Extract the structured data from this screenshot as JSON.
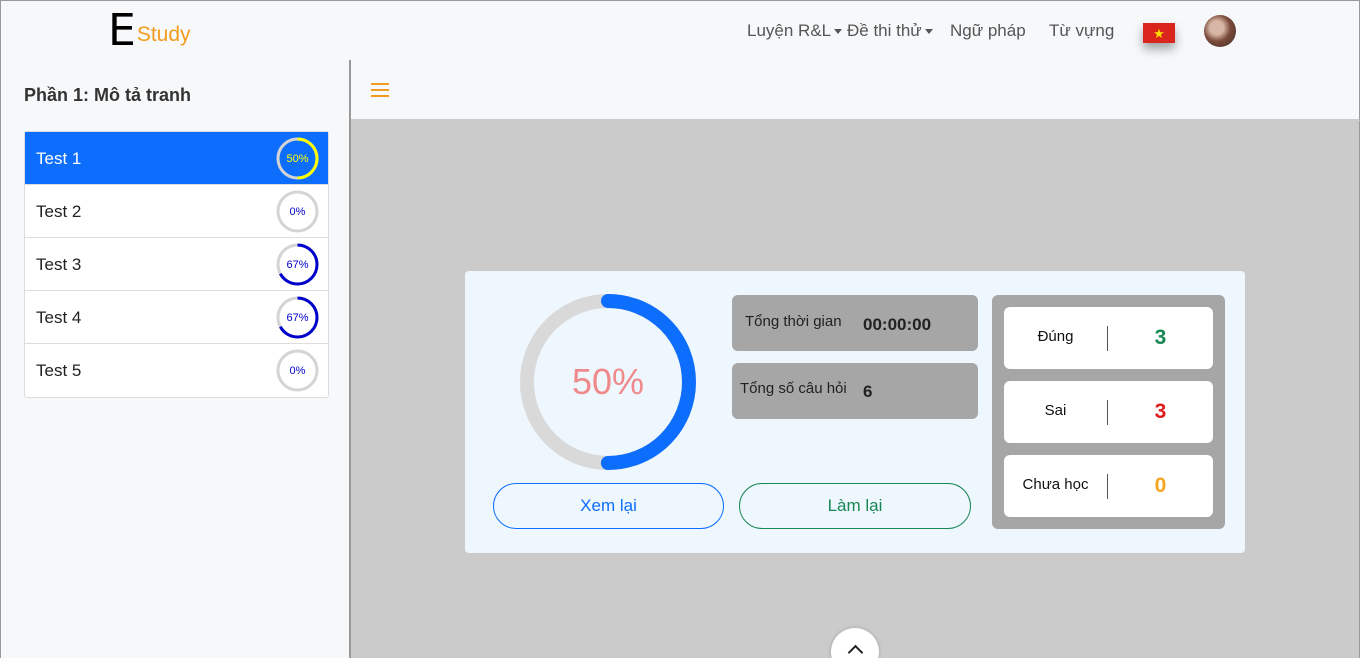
{
  "brand": {
    "letter": "E",
    "name": "Study"
  },
  "nav": {
    "practice": "Luyện R&L",
    "mock_test": "Đề thi thử",
    "grammar": "Ngữ pháp",
    "vocabulary": "Từ vựng",
    "language_flag": "vietnam-flag-icon"
  },
  "sidebar": {
    "title": "Phần 1: Mô tả tranh",
    "tests": [
      {
        "label": "Test 1",
        "progress": "50%",
        "value": 0.5,
        "ring_color": "#ffff00",
        "active": true
      },
      {
        "label": "Test 2",
        "progress": "0%",
        "value": 0,
        "ring_color": "#0000cc",
        "active": false
      },
      {
        "label": "Test 3",
        "progress": "67%",
        "value": 0.67,
        "ring_color": "#0000cc",
        "active": false
      },
      {
        "label": "Test 4",
        "progress": "67%",
        "value": 0.67,
        "ring_color": "#0000cc",
        "active": false
      },
      {
        "label": "Test 5",
        "progress": "0%",
        "value": 0,
        "ring_color": "#0000cc",
        "active": false
      }
    ]
  },
  "result": {
    "percent_label": "50%",
    "percent_value": 0.5,
    "ring_color": "#0d6efd",
    "total_time_label": "Tổng thời gian",
    "total_time": "00:00:00",
    "total_questions_label": "Tổng số câu hỏi",
    "total_questions": "6",
    "review_button": "Xem lại",
    "retry_button": "Làm lại",
    "correct_label": "Đúng",
    "correct": "3",
    "correct_color": "#198754",
    "wrong_label": "Sai",
    "wrong": "3",
    "wrong_color": "#e01b1b",
    "unlearned_label": "Chưa học",
    "unlearned": "0",
    "unlearned_color": "#f5a623"
  }
}
